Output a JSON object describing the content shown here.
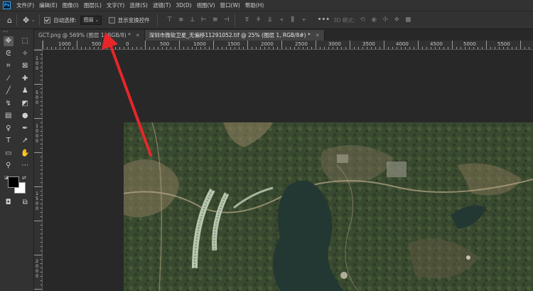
{
  "app": {
    "logo": "Ps"
  },
  "menu": [
    "文件(F)",
    "编辑(E)",
    "图像(I)",
    "图层(L)",
    "文字(Y)",
    "选择(S)",
    "滤镜(T)",
    "3D(D)",
    "视图(V)",
    "窗口(W)",
    "帮助(H)"
  ],
  "options": {
    "auto_select_label": "自动选择:",
    "auto_select_checked": true,
    "layer_select_value": "图层",
    "show_transform_label": "显示变换控件",
    "show_transform_checked": false,
    "mode_3d_label": "3D 模式:"
  },
  "tabs": [
    {
      "label": "GCT.png @ 569% (图层 1, RGB/8) *",
      "active": false
    },
    {
      "label": "深圳市微软卫星_无偏移11291052.tif @ 25% (图层 1, RGB/8#) *",
      "active": true
    }
  ],
  "ruler": {
    "h_labels": [
      "1000",
      "500",
      "0",
      "500",
      "1000",
      "1500",
      "2000",
      "2500",
      "3000",
      "3500",
      "4000",
      "4500",
      "5000",
      "5500"
    ],
    "v_labels": [
      "1",
      "0",
      "0",
      "5",
      "0",
      "0",
      "1",
      "0",
      "0",
      "0",
      "1",
      "5",
      "0",
      "0",
      "2",
      "0",
      "0",
      "0"
    ]
  },
  "colors": {
    "foreground": "#000000",
    "background": "#ffffff",
    "annotation_arrow": "#e8262a"
  },
  "icons": {
    "home": "home-icon",
    "move": "move-icon",
    "more": "more-icon"
  }
}
